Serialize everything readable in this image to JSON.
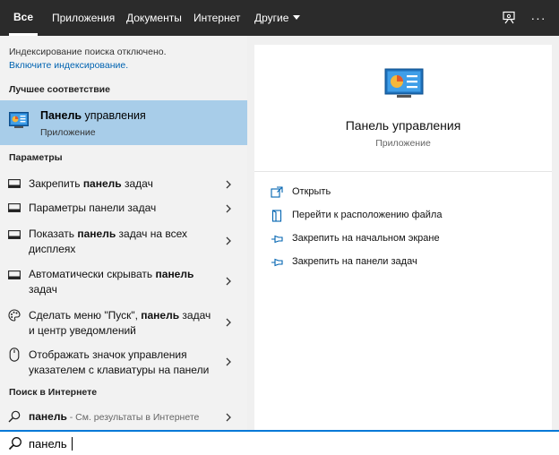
{
  "tabs": [
    {
      "label": "Все",
      "active": true
    },
    {
      "label": "Приложения"
    },
    {
      "label": "Документы"
    },
    {
      "label": "Интернет"
    },
    {
      "label": "Другие"
    }
  ],
  "topbar_icons": [
    "feedback-icon",
    "more-icon"
  ],
  "more_label": "···",
  "left": {
    "notice": "Индексирование поиска отключено.",
    "notice_link": "Включите индексирование.",
    "best_match_heading": "Лучшее соответствие",
    "best_match": {
      "title_bold": "Панель",
      "title_rest": " управления",
      "subtitle": "Приложение",
      "icon": "control-panel-icon"
    },
    "settings_heading": "Параметры",
    "settings": [
      {
        "icon": "taskbar-icon",
        "pre": "Закрепить ",
        "bold": "панель",
        "post": " задач"
      },
      {
        "icon": "taskbar-icon",
        "pre": "Параметры панели задач",
        "bold": "",
        "post": ""
      },
      {
        "icon": "taskbar-icon",
        "pre": "Показать ",
        "bold": "панель",
        "post": " задач на всех дисплеях"
      },
      {
        "icon": "taskbar-icon",
        "pre": "Автоматически скрывать ",
        "bold": "панель",
        "post": " задач"
      },
      {
        "icon": "palette-icon",
        "pre": "Сделать меню \"Пуск\", ",
        "bold": "панель",
        "post": " задач и центр уведомлений"
      },
      {
        "icon": "mouse-icon",
        "pre": "Отображать значок управления указателем с клавиатуры на панели",
        "bold": "",
        "post": ""
      }
    ],
    "web_heading": "Поиск в Интернете",
    "web_result": {
      "term": "панель",
      "hint": " - См. результаты в Интернете",
      "icon": "search-icon"
    }
  },
  "right": {
    "title": "Панель управления",
    "subtitle": "Приложение",
    "actions": [
      {
        "label": "Открыть",
        "icon": "open-icon"
      },
      {
        "label": "Перейти к расположению файла",
        "icon": "folder-icon"
      },
      {
        "label": "Закрепить на начальном экране",
        "icon": "pin-icon"
      },
      {
        "label": "Закрепить на панели задач",
        "icon": "pin-icon"
      }
    ]
  },
  "search": {
    "value": "панель",
    "icon": "search-icon"
  },
  "colors": {
    "topbar": "#2b2b2b",
    "selected": "#a8cde9",
    "accent": "#0078d7",
    "link": "#0063b1"
  }
}
